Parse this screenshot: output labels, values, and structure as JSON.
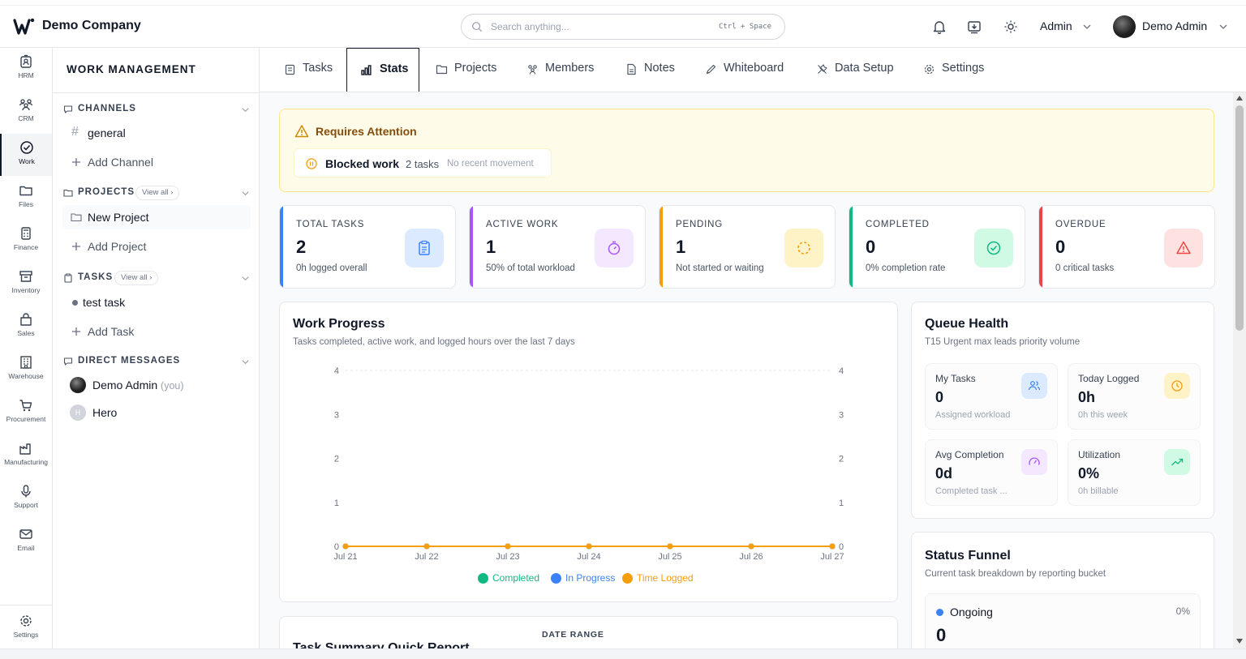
{
  "header": {
    "company": "Demo Company",
    "search_placeholder": "Search anything...",
    "search_shortcut": "Ctrl + Space",
    "role": "Admin",
    "user_name": "Demo Admin",
    "icons": [
      "bell-icon",
      "download-icon",
      "sun-icon"
    ]
  },
  "rail": {
    "items": [
      {
        "label": "HRM",
        "icon": "id-badge-icon"
      },
      {
        "label": "CRM",
        "icon": "users-icon"
      },
      {
        "label": "Work",
        "icon": "check-circle-icon"
      },
      {
        "label": "Files",
        "icon": "folder-icon"
      },
      {
        "label": "Finance",
        "icon": "calculator-icon"
      },
      {
        "label": "Inventory",
        "icon": "archive-icon"
      },
      {
        "label": "Sales",
        "icon": "shopping-bag-icon"
      },
      {
        "label": "Warehouse",
        "icon": "building-icon"
      },
      {
        "label": "Procurement",
        "icon": "cart-icon"
      },
      {
        "label": "Manufacturing",
        "icon": "factory-icon"
      },
      {
        "label": "Support",
        "icon": "mic-icon"
      },
      {
        "label": "Email",
        "icon": "mail-icon"
      }
    ],
    "settings_label": "Settings",
    "active": "Work"
  },
  "panel": {
    "title": "WORK MANAGEMENT",
    "channels": {
      "heading": "CHANNELS",
      "items": [
        "general"
      ],
      "add": "Add Channel"
    },
    "projects": {
      "heading": "PROJECTS",
      "view_all": "View all",
      "items": [
        "New Project"
      ],
      "add": "Add Project"
    },
    "tasks": {
      "heading": "TASKS",
      "view_all": "View all",
      "items": [
        "test task"
      ],
      "add": "Add Task"
    },
    "direct_messages": {
      "heading": "DIRECT MESSAGES",
      "items": [
        {
          "name": "Demo Admin",
          "suffix": "(you)"
        },
        {
          "name": "Hero",
          "initial": "H"
        }
      ]
    }
  },
  "tabs": [
    {
      "label": "Tasks",
      "icon": "clipboard-icon"
    },
    {
      "label": "Stats",
      "icon": "bar-chart-icon",
      "active": true
    },
    {
      "label": "Projects",
      "icon": "folder-icon"
    },
    {
      "label": "Members",
      "icon": "users-icon"
    },
    {
      "label": "Notes",
      "icon": "file-text-icon"
    },
    {
      "label": "Whiteboard",
      "icon": "pen-icon"
    },
    {
      "label": "Data Setup",
      "icon": "tools-icon"
    },
    {
      "label": "Settings",
      "icon": "gear-icon"
    }
  ],
  "attention": {
    "title": "Requires Attention",
    "item_label": "Blocked work",
    "item_count": "2 tasks",
    "item_note": "No recent movement"
  },
  "stats": [
    {
      "label": "TOTAL TASKS",
      "value": "2",
      "sub": "0h logged overall",
      "color": "#3b82f6",
      "icon": "clipboard-list-icon"
    },
    {
      "label": "ACTIVE WORK",
      "value": "1",
      "sub": "50% of total workload",
      "color": "#a855f7",
      "icon": "timer-icon"
    },
    {
      "label": "PENDING",
      "value": "1",
      "sub": "Not started or waiting",
      "color": "#f59e0b",
      "icon": "loader-icon"
    },
    {
      "label": "COMPLETED",
      "value": "0",
      "sub": "0% completion rate",
      "color": "#10b981",
      "icon": "check-circle-icon"
    },
    {
      "label": "OVERDUE",
      "value": "0",
      "sub": "0 critical tasks",
      "color": "#ef4444",
      "icon": "alert-triangle-icon"
    }
  ],
  "work_progress": {
    "title": "Work Progress",
    "subtitle": "Tasks completed, active work, and logged hours over the last 7 days"
  },
  "chart_data": {
    "type": "line",
    "title": "",
    "categories": [
      "Jul 21",
      "Jul 22",
      "Jul 23",
      "Jul 24",
      "Jul 25",
      "Jul 26",
      "Jul 27"
    ],
    "series": [
      {
        "name": "Completed",
        "color": "#10b981",
        "values": [
          0,
          0,
          0,
          0,
          0,
          0,
          0
        ]
      },
      {
        "name": "In Progress",
        "color": "#3b82f6",
        "values": [
          0,
          0,
          0,
          0,
          0,
          0,
          0
        ]
      },
      {
        "name": "Time Logged",
        "color": "#f59e0b",
        "values": [
          0,
          0,
          0,
          0,
          0,
          0,
          0
        ]
      }
    ],
    "y_ticks_left": [
      0,
      1,
      2,
      3,
      4
    ],
    "y_ticks_right": [
      0,
      1,
      2,
      3,
      4
    ],
    "ylim": [
      0,
      4
    ],
    "legend_position": "bottom",
    "grid": "top-dashed"
  },
  "queue_health": {
    "title": "Queue Health",
    "subtitle": "T15 Urgent max leads priority volume",
    "tiles": [
      {
        "label": "My Tasks",
        "value": "0",
        "sub": "Assigned workload",
        "icon": "users-icon",
        "color": "#3b82f6",
        "bg": "#dbeafe"
      },
      {
        "label": "Today Logged",
        "value": "0h",
        "sub": "0h this week",
        "icon": "clock-icon",
        "color": "#f59e0b",
        "bg": "#fef3c7"
      },
      {
        "label": "Avg Completion",
        "value": "0d",
        "sub": "Completed task ...",
        "icon": "gauge-icon",
        "color": "#a855f7",
        "bg": "#f3e8ff"
      },
      {
        "label": "Utilization",
        "value": "0%",
        "sub": "0h billable",
        "icon": "trending-up-icon",
        "color": "#10b981",
        "bg": "#d1fae5"
      }
    ]
  },
  "status_funnel": {
    "title": "Status Funnel",
    "subtitle": "Current task breakdown by reporting bucket",
    "row_label": "Ongoing",
    "row_percent": "0%",
    "row_value": "0"
  },
  "task_summary": {
    "title": "Task Summary Quick Report",
    "date_range_label": "DATE RANGE"
  }
}
